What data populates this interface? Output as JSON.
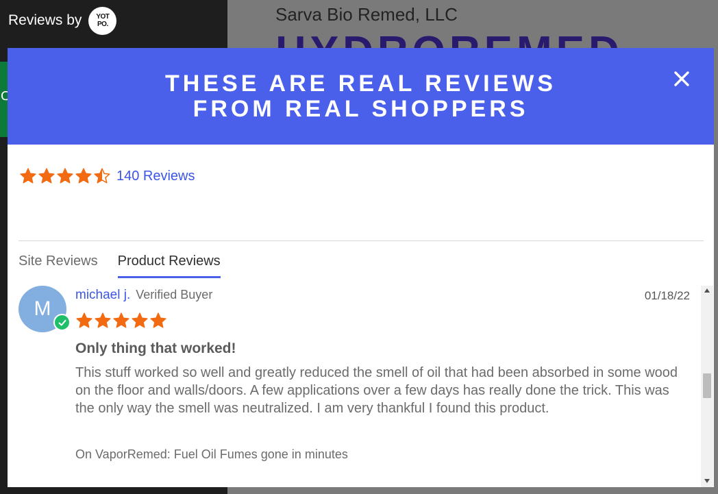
{
  "brand": {
    "label": "Reviews by",
    "logo_line1": "YOT",
    "logo_line2": "PO."
  },
  "background": {
    "company": "Sarva Bio Remed, LLC",
    "headline": "HYDROREMED",
    "side_glyph": "C"
  },
  "modal": {
    "title_line1": "THESE ARE REAL REVIEWS",
    "title_line2": "FROM REAL SHOPPERS",
    "header_color": "#4a60ea"
  },
  "summary": {
    "rating": 4.5,
    "review_count": "140 Reviews",
    "star_color": "#f26a11"
  },
  "tabs": [
    {
      "label": "Site Reviews",
      "active": false
    },
    {
      "label": "Product Reviews",
      "active": true
    }
  ],
  "review": {
    "avatar_letter": "M",
    "name": "michael j.",
    "badge": "Verified Buyer",
    "date": "01/18/22",
    "rating": 5,
    "title": "Only thing that worked!",
    "body": "This stuff worked so well and greatly reduced the smell of oil that had been absorbed in some wood on the floor and walls/doors. A few applications over a few days has really done the trick. This was the only way the smell was neutralized. I am very thankful I found this product.",
    "product": "On VaporRemed: Fuel Oil Fumes gone in minutes"
  },
  "icons": {
    "close": "close-icon",
    "verified": "check-icon",
    "star": "star-icon"
  }
}
